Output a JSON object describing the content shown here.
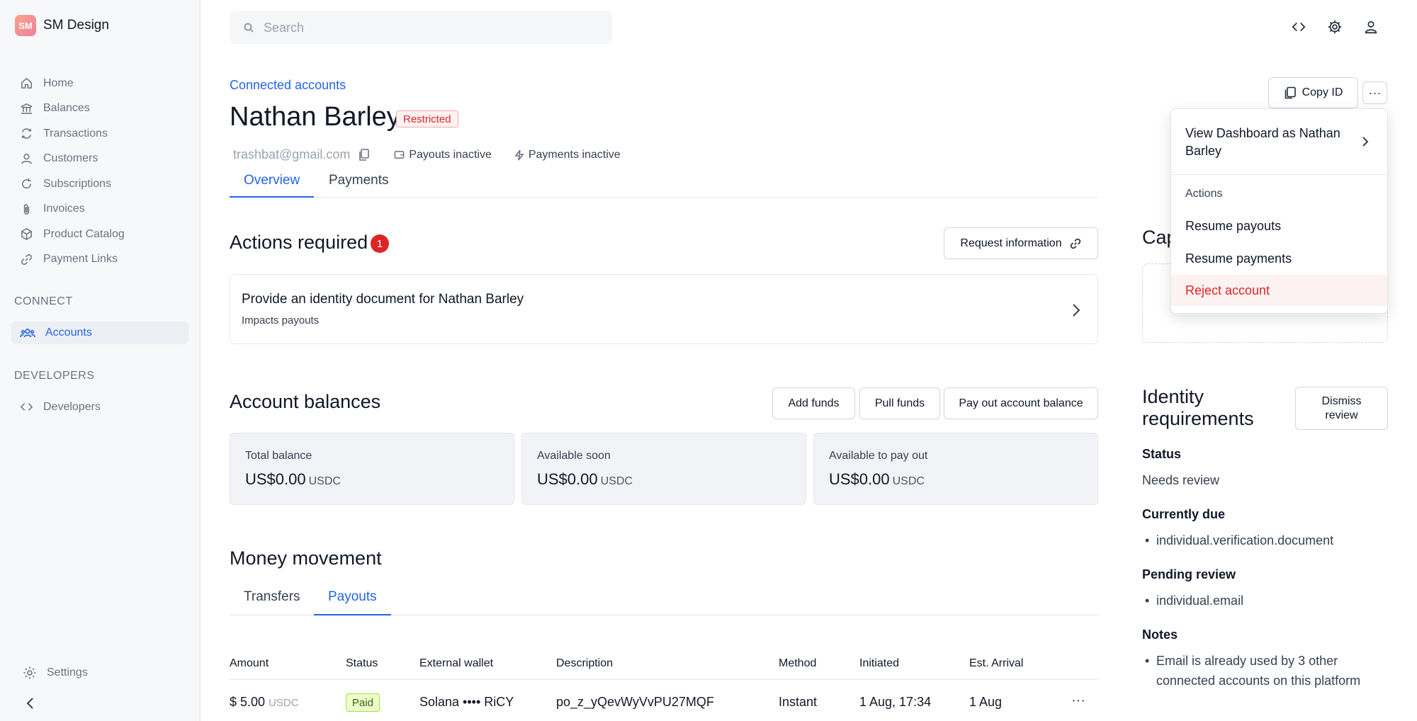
{
  "brand": {
    "logo_text": "SM",
    "name": "SM Design"
  },
  "sidebar": {
    "items": [
      {
        "label": "Home",
        "icon": "home-icon"
      },
      {
        "label": "Balances",
        "icon": "bank-icon"
      },
      {
        "label": "Transactions",
        "icon": "transactions-icon"
      },
      {
        "label": "Customers",
        "icon": "user-icon"
      },
      {
        "label": "Subscriptions",
        "icon": "refresh-icon"
      },
      {
        "label": "Invoices",
        "icon": "paperclip-icon"
      },
      {
        "label": "Product Catalog",
        "icon": "box-icon"
      },
      {
        "label": "Payment Links",
        "icon": "link-icon"
      }
    ],
    "connect_section": "CONNECT",
    "accounts_label": "Accounts",
    "developers_section": "DEVELOPERS",
    "developers_label": "Developers",
    "settings_label": "Settings"
  },
  "search": {
    "placeholder": "Search"
  },
  "header": {
    "breadcrumb": "Connected accounts",
    "title": "Nathan Barley",
    "status_badge": "Restricted",
    "email": "trashbat@gmail.com",
    "payouts_status": "Payouts inactive",
    "payments_status": "Payments inactive",
    "copy_id_label": "Copy ID",
    "more_label": "···"
  },
  "tabs": [
    {
      "label": "Overview",
      "active": true
    },
    {
      "label": "Payments",
      "active": false
    }
  ],
  "actions_required": {
    "title": "Actions required",
    "count": "1",
    "request_button": "Request information",
    "item_title": "Provide an identity document for Nathan Barley",
    "item_sub": "Impacts payouts"
  },
  "balances": {
    "title": "Account balances",
    "buttons": [
      "Add funds",
      "Pull funds",
      "Pay out account balance"
    ],
    "cards": [
      {
        "label": "Total balance",
        "value": "US$0.00",
        "unit": "USDC"
      },
      {
        "label": "Available soon",
        "value": "US$0.00",
        "unit": "USDC"
      },
      {
        "label": "Available to pay out",
        "value": "US$0.00",
        "unit": "USDC"
      }
    ]
  },
  "money_movement": {
    "title": "Money movement",
    "tabs": [
      {
        "label": "Transfers",
        "active": false
      },
      {
        "label": "Payouts",
        "active": true
      }
    ],
    "columns": [
      "Amount",
      "Status",
      "External wallet",
      "Description",
      "Method",
      "Initiated",
      "Est. Arrival"
    ],
    "rows": [
      {
        "amount": "$ 5.00",
        "unit": "USDC",
        "status": "Paid",
        "wallet": "Solana •••• RiCY",
        "description": "po_z_yQevWyVvPU27MQF",
        "method": "Instant",
        "initiated": "1 Aug, 17:34",
        "arrival": "1 Aug",
        "more": "···"
      }
    ]
  },
  "right_panel": {
    "cap_title": "Cap",
    "identity_title": "Identity requirements",
    "dismiss_button": "Dismiss review",
    "status_label": "Status",
    "status_value": "Needs review",
    "currently_due_label": "Currently due",
    "currently_due": [
      "individual.verification.document"
    ],
    "pending_label": "Pending review",
    "pending": [
      "individual.email"
    ],
    "notes_label": "Notes",
    "notes": [
      "Email is already used by 3 other connected accounts on this platform"
    ]
  },
  "dropdown": {
    "view_dashboard": "View Dashboard as Nathan Barley",
    "section": "Actions",
    "items": [
      "Resume payouts",
      "Resume payments",
      "Reject account"
    ]
  },
  "colors": {
    "accent": "#2563eb",
    "danger": "#dc2626",
    "sidebar_bg": "#f7f8fa"
  }
}
